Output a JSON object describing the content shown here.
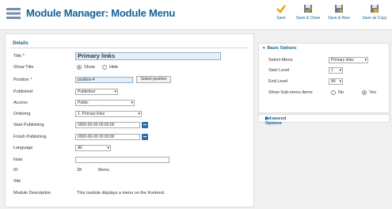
{
  "header": {
    "title": "Module Manager: Module Menu",
    "toolbar": [
      {
        "label": "Save",
        "icon": "save-icon"
      },
      {
        "label": "Save & Close",
        "icon": "save-close-icon"
      },
      {
        "label": "Save & New",
        "icon": "save-new-icon"
      },
      {
        "label": "Save as Copy",
        "icon": "save-copy-icon"
      }
    ]
  },
  "details": {
    "legend": "Details",
    "title_label": "Title",
    "title_value": "Primary links",
    "show_title_label": "Show Title",
    "show_option": "Show",
    "hide_option": "Hide",
    "position_label": "Position",
    "position_value": "position-4",
    "select_position": "Select position",
    "published_label": "Published",
    "published_value": "Published",
    "access_label": "Access",
    "access_value": "Public",
    "ordering_label": "Ordering",
    "ordering_value": "1. Primary links",
    "start_label": "Start Publishing",
    "start_value": "0000-00-00 00:00:00",
    "finish_label": "Finish Publishing",
    "finish_value": "0000-00-00 00:00:00",
    "language_label": "Language",
    "language_value": "All",
    "note_label": "Note",
    "note_value": "",
    "id_label": "ID",
    "id_value": "28",
    "id_type": "Menu",
    "site_label": "Site",
    "desc_label": "Module Description",
    "desc_value": "This module displays a menu on the frontend."
  },
  "basic": {
    "title": "Basic Options",
    "select_menu_label": "Select Menu",
    "select_menu_value": "Primary links",
    "start_level_label": "Start Level",
    "start_level_value": "1",
    "end_level_label": "End Level",
    "end_level_value": "All",
    "show_sub_label": "Show Sub-menu Items",
    "no_option": "No",
    "yes_option": "Yes"
  },
  "advanced": {
    "title": "Advanced Options"
  },
  "colors": {
    "accent": "#146295",
    "toolbar_icon": "#e8a020"
  }
}
